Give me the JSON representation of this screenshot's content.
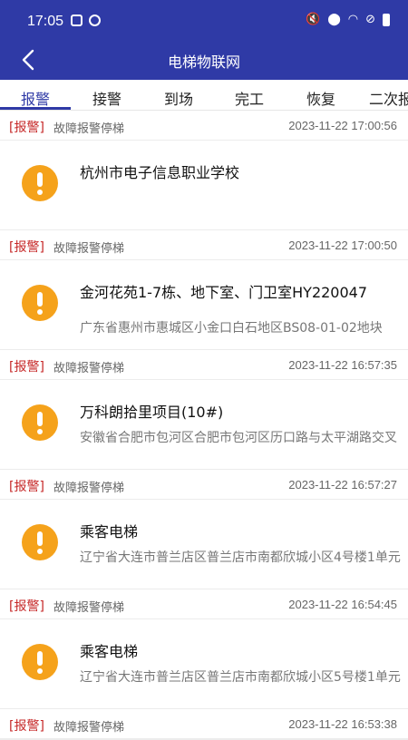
{
  "status_bar": {
    "time": "17:05",
    "left_icons": [
      "notification-icon",
      "location-app-icon"
    ],
    "right_icons": [
      "mute-icon",
      "location-icon",
      "wifi-icon",
      "dnd-icon",
      "battery-icon"
    ]
  },
  "header": {
    "title": "电梯物联网",
    "back_icon": "chevron-left-icon"
  },
  "tabs": [
    {
      "label": "报警",
      "active": true
    },
    {
      "label": "接警",
      "active": false
    },
    {
      "label": "到场",
      "active": false
    },
    {
      "label": "完工",
      "active": false
    },
    {
      "label": "恢复",
      "active": false
    },
    {
      "label": "二次报",
      "active": false
    }
  ],
  "colors": {
    "primary": "#2f3aa6",
    "alarm_tag": "#c62828",
    "warning_icon": "#f5a21b"
  },
  "items": [
    {
      "tag": "[报警]",
      "type": "故障报警停梯",
      "time": "2023-11-22 17:00:56",
      "name": "杭州市电子信息职业学校",
      "address": ""
    },
    {
      "tag": "[报警]",
      "type": "故障报警停梯",
      "time": "2023-11-22 17:00:50",
      "name": "金河花苑1-7栋、地下室、门卫室HY220047",
      "address": "广东省惠州市惠城区小金口白石地区BS08-01-02地块"
    },
    {
      "tag": "[报警]",
      "type": "故障报警停梯",
      "time": "2023-11-22 16:57:35",
      "name": "万科朗拾里项目(10#)",
      "address": "安徽省合肥市包河区合肥市包河区历口路与太平湖路交叉"
    },
    {
      "tag": "[报警]",
      "type": "故障报警停梯",
      "time": "2023-11-22 16:57:27",
      "name": "乘客电梯",
      "address": "辽宁省大连市普兰店区普兰店市南都欣城小区4号楼1单元"
    },
    {
      "tag": "[报警]",
      "type": "故障报警停梯",
      "time": "2023-11-22 16:54:45",
      "name": "乘客电梯",
      "address": "辽宁省大连市普兰店区普兰店市南都欣城小区5号楼1单元"
    },
    {
      "tag": "[报警]",
      "type": "故障报警停梯",
      "time": "2023-11-22 16:53:38",
      "name": "",
      "address": ""
    }
  ]
}
